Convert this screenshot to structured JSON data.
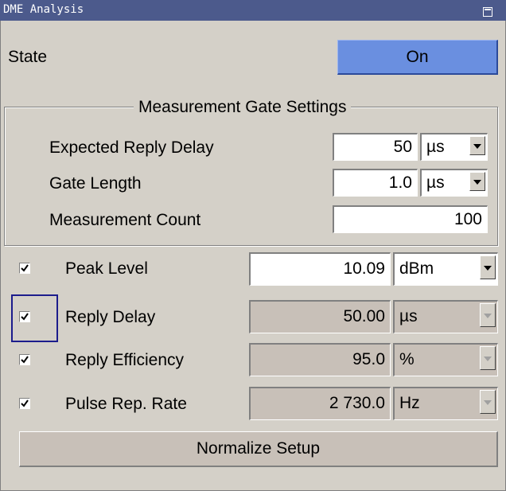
{
  "window": {
    "title": "DME Analysis"
  },
  "state": {
    "label": "State",
    "value": "On"
  },
  "gate_settings": {
    "title": "Measurement Gate Settings",
    "expected_reply_delay": {
      "label": "Expected Reply Delay",
      "value": "50",
      "unit": "µs"
    },
    "gate_length": {
      "label": "Gate Length",
      "value": "1.0",
      "unit": "µs"
    },
    "measurement_count": {
      "label": "Measurement Count",
      "value": "100"
    }
  },
  "results": [
    {
      "label": "Peak Level",
      "value": "10.09",
      "unit": "dBm",
      "checked": true,
      "editable": true
    },
    {
      "label": "Reply Delay",
      "value": "50.00",
      "unit": "µs",
      "checked": true,
      "editable": false
    },
    {
      "label": "Reply Efficiency",
      "value": "95.0",
      "unit": "%",
      "checked": true,
      "editable": false
    },
    {
      "label": "Pulse Rep. Rate",
      "value": "2 730.0",
      "unit": "Hz",
      "checked": true,
      "editable": false
    }
  ],
  "normalize_label": "Normalize Setup",
  "colors": {
    "titlebar": "#4c5a8c",
    "state_on": "#6a8fe0",
    "panel": "#d4d0c8",
    "readonly_field": "#c8c0b8"
  }
}
